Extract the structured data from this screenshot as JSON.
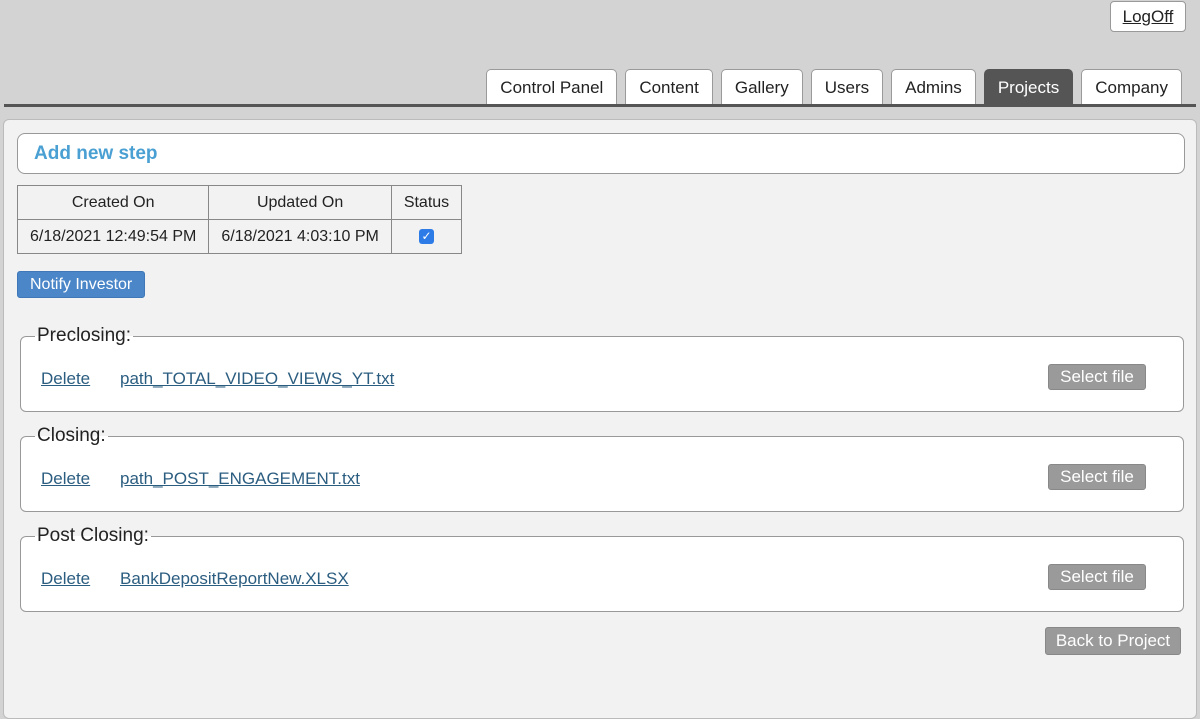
{
  "header": {
    "logoff_label": "LogOff",
    "tabs": [
      {
        "label": "Control Panel",
        "active": false
      },
      {
        "label": "Content",
        "active": false
      },
      {
        "label": "Gallery",
        "active": false
      },
      {
        "label": "Users",
        "active": false
      },
      {
        "label": "Admins",
        "active": false
      },
      {
        "label": "Projects",
        "active": true
      },
      {
        "label": "Company",
        "active": false
      }
    ]
  },
  "main": {
    "add_step_label": "Add new step",
    "info_table": {
      "headers": [
        "Created On",
        "Updated On",
        "Status"
      ],
      "row": {
        "created_on": "6/18/2021 12:49:54 PM",
        "updated_on": "6/18/2021 4:03:10 PM",
        "status_checked": true
      }
    },
    "notify_label": "Notify Investor",
    "sections": [
      {
        "legend": "Preclosing:",
        "delete_label": "Delete",
        "file_name": "path_TOTAL_VIDEO_VIEWS_YT.txt",
        "select_label": "Select file"
      },
      {
        "legend": "Closing:",
        "delete_label": "Delete",
        "file_name": "path_POST_ENGAGEMENT.txt",
        "select_label": "Select file"
      },
      {
        "legend": "Post Closing:",
        "delete_label": "Delete",
        "file_name": "BankDepositReportNew.XLSX",
        "select_label": "Select file"
      }
    ],
    "back_label": "Back to Project"
  },
  "icons": {
    "check": "checkbox-checked-icon"
  },
  "colors": {
    "accent": "#4aa0d2",
    "primary_button": "#4a86c8",
    "active_tab": "#555555",
    "link": "#2b5d80",
    "secondary_button": "#9a9a9a"
  }
}
